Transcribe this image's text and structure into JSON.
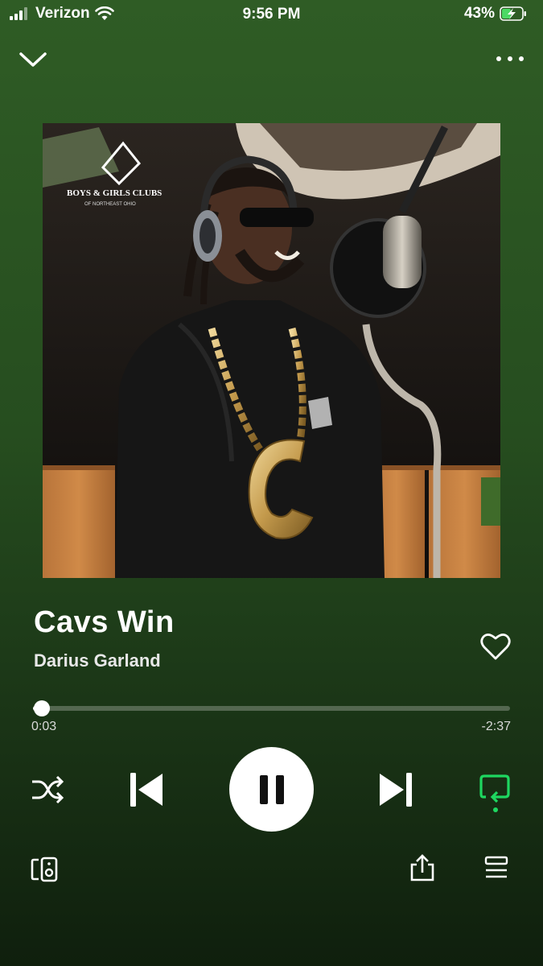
{
  "status_bar": {
    "carrier": "Verizon",
    "time": "9:56 PM",
    "battery": "43%"
  },
  "header": {
    "collapse_icon": "chevron-down-icon",
    "more_icon": "more-horizontal-icon"
  },
  "album_art": {
    "overlay_text_line1": "BOYS & GIRLS CLUBS",
    "overlay_text_line2": "OF NORTHEAST OHIO"
  },
  "track": {
    "title": "Cavs Win",
    "artist": "Darius Garland",
    "elapsed": "0:03",
    "remaining": "-2:37",
    "progress_fraction": 0.019
  },
  "controls": {
    "shuffle_icon": "shuffle-icon",
    "previous_icon": "skip-previous-icon",
    "play_pause_icon": "pause-icon",
    "next_icon": "skip-next-icon",
    "repeat_icon": "repeat-icon",
    "accent_color": "#1ed760"
  },
  "footer": {
    "devices_icon": "connect-devices-icon",
    "share_icon": "share-icon",
    "queue_icon": "queue-icon"
  }
}
